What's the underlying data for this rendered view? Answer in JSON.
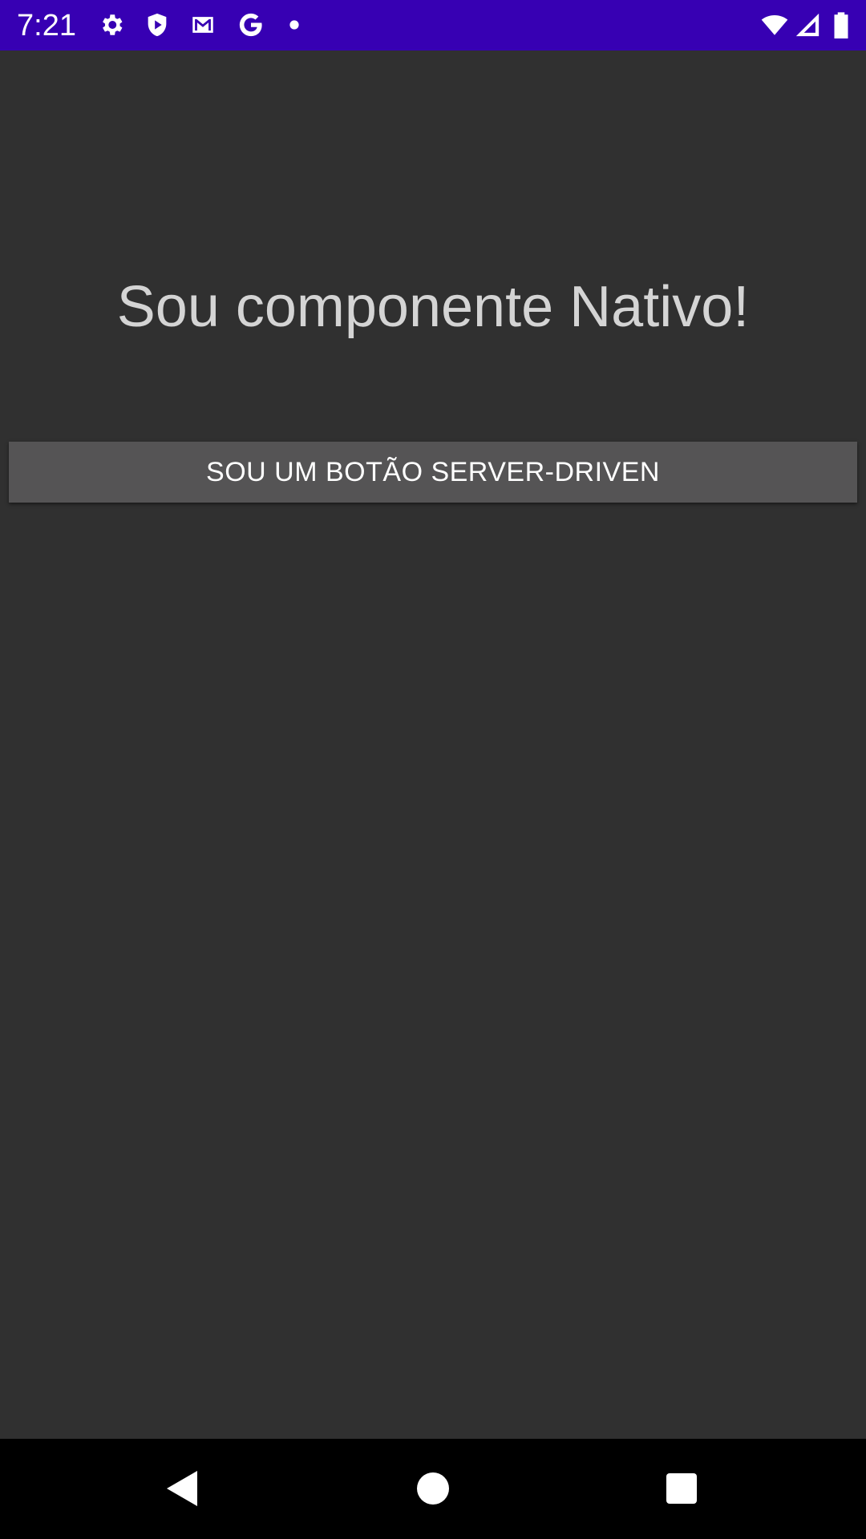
{
  "status_bar": {
    "time": "7:21",
    "background_color": "#3700b3",
    "left_icons": [
      "settings-gear-icon",
      "shield-play-icon",
      "gmail-icon",
      "google-g-icon",
      "notification-dot-icon"
    ],
    "right_icons": [
      "wifi-icon",
      "cellular-signal-icon",
      "battery-icon"
    ]
  },
  "content": {
    "title": "Sou componente Nativo!",
    "button_label": "SOU UM BOTÃO SERVER-DRIVEN"
  },
  "nav_bar": {
    "icons": [
      "back-icon",
      "home-icon",
      "recents-icon"
    ]
  },
  "colors": {
    "background": "#303030",
    "button_background": "#555455",
    "title_text": "#d4d4d4"
  }
}
